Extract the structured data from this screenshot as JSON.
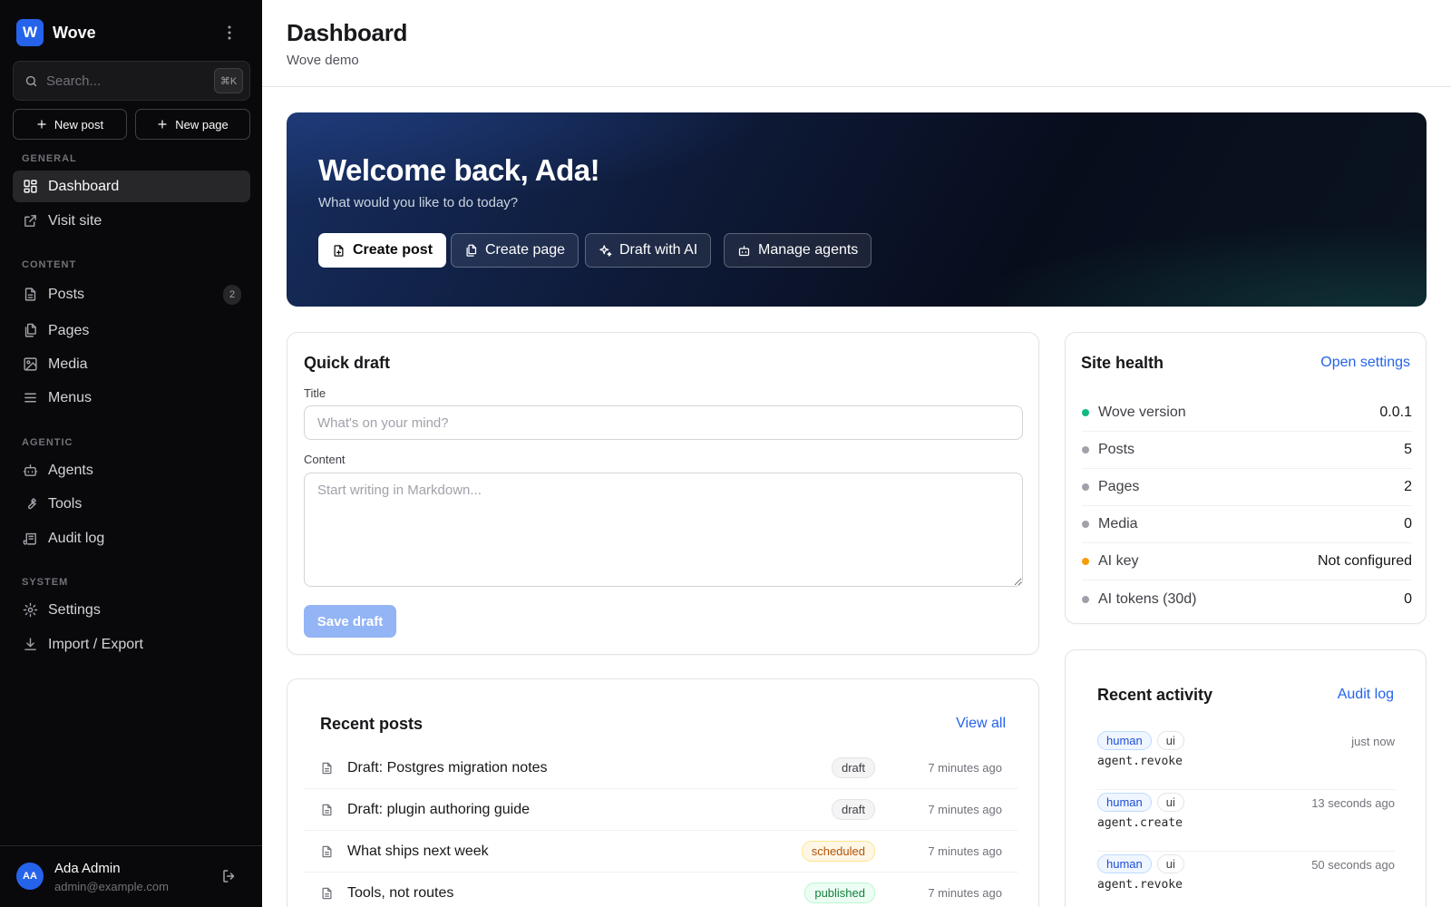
{
  "brand": {
    "logo_letter": "W",
    "name": "Wove",
    "accent": "#2563eb"
  },
  "search": {
    "placeholder": "Search...",
    "shortcut": "⌘K"
  },
  "quick_actions": {
    "new_post": "New post",
    "new_page": "New page"
  },
  "sidebar": {
    "sections": [
      {
        "label": "GENERAL",
        "items": [
          {
            "label": "Dashboard",
            "icon": "layout-grid-icon",
            "active": true
          },
          {
            "label": "Visit site",
            "icon": "external-link-icon"
          }
        ]
      },
      {
        "label": "CONTENT",
        "items": [
          {
            "label": "Posts",
            "icon": "file-text-icon",
            "badge": "2"
          },
          {
            "label": "Pages",
            "icon": "files-icon"
          },
          {
            "label": "Media",
            "icon": "image-icon"
          },
          {
            "label": "Menus",
            "icon": "menu-icon"
          }
        ]
      },
      {
        "label": "AGENTIC",
        "items": [
          {
            "label": "Agents",
            "icon": "bot-icon"
          },
          {
            "label": "Tools",
            "icon": "wrench-icon"
          },
          {
            "label": "Audit log",
            "icon": "scroll-icon"
          }
        ]
      },
      {
        "label": "SYSTEM",
        "items": [
          {
            "label": "Settings",
            "icon": "gear-icon"
          },
          {
            "label": "Import / Export",
            "icon": "download-icon"
          }
        ]
      }
    ]
  },
  "user": {
    "initials": "AA",
    "name": "Ada Admin",
    "email": "admin@example.com"
  },
  "header": {
    "title": "Dashboard",
    "subtitle": "Wove demo"
  },
  "hero": {
    "title": "Welcome back, Ada!",
    "subtitle": "What would you like to do today?",
    "buttons": [
      "Create post",
      "Create page",
      "Draft with AI",
      "Manage agents"
    ]
  },
  "quick_draft": {
    "title": "Quick draft",
    "title_label": "Title",
    "title_placeholder": "What's on your mind?",
    "content_label": "Content",
    "content_placeholder": "Start writing in Markdown...",
    "save_label": "Save draft"
  },
  "site_health": {
    "title": "Site health",
    "link": "Open settings",
    "rows": [
      {
        "label": "Wove version",
        "value": "0.0.1",
        "status_color": "#10b981"
      },
      {
        "label": "Posts",
        "value": "5",
        "status_color": "#a1a1aa"
      },
      {
        "label": "Pages",
        "value": "2",
        "status_color": "#a1a1aa"
      },
      {
        "label": "Media",
        "value": "0",
        "status_color": "#a1a1aa"
      },
      {
        "label": "AI key",
        "value": "Not configured",
        "status_color": "#f59e0b"
      },
      {
        "label": "AI tokens (30d)",
        "value": "0",
        "status_color": "#a1a1aa"
      }
    ]
  },
  "recent_posts": {
    "title": "Recent posts",
    "link": "View all",
    "rows": [
      {
        "title": "Draft: Postgres migration notes",
        "status": "draft",
        "time": "7 minutes ago"
      },
      {
        "title": "Draft: plugin authoring guide",
        "status": "draft",
        "time": "7 minutes ago"
      },
      {
        "title": "What ships next week",
        "status": "scheduled",
        "time": "7 minutes ago"
      },
      {
        "title": "Tools, not routes",
        "status": "published",
        "time": "7 minutes ago"
      }
    ]
  },
  "recent_activity": {
    "title": "Recent activity",
    "link": "Audit log",
    "rows": [
      {
        "tags": [
          "human",
          "ui"
        ],
        "action": "agent.revoke",
        "time": "just now"
      },
      {
        "tags": [
          "human",
          "ui"
        ],
        "action": "agent.create",
        "time": "13 seconds ago"
      },
      {
        "tags": [
          "human",
          "ui"
        ],
        "action": "agent.revoke",
        "time": "50 seconds ago"
      }
    ]
  }
}
